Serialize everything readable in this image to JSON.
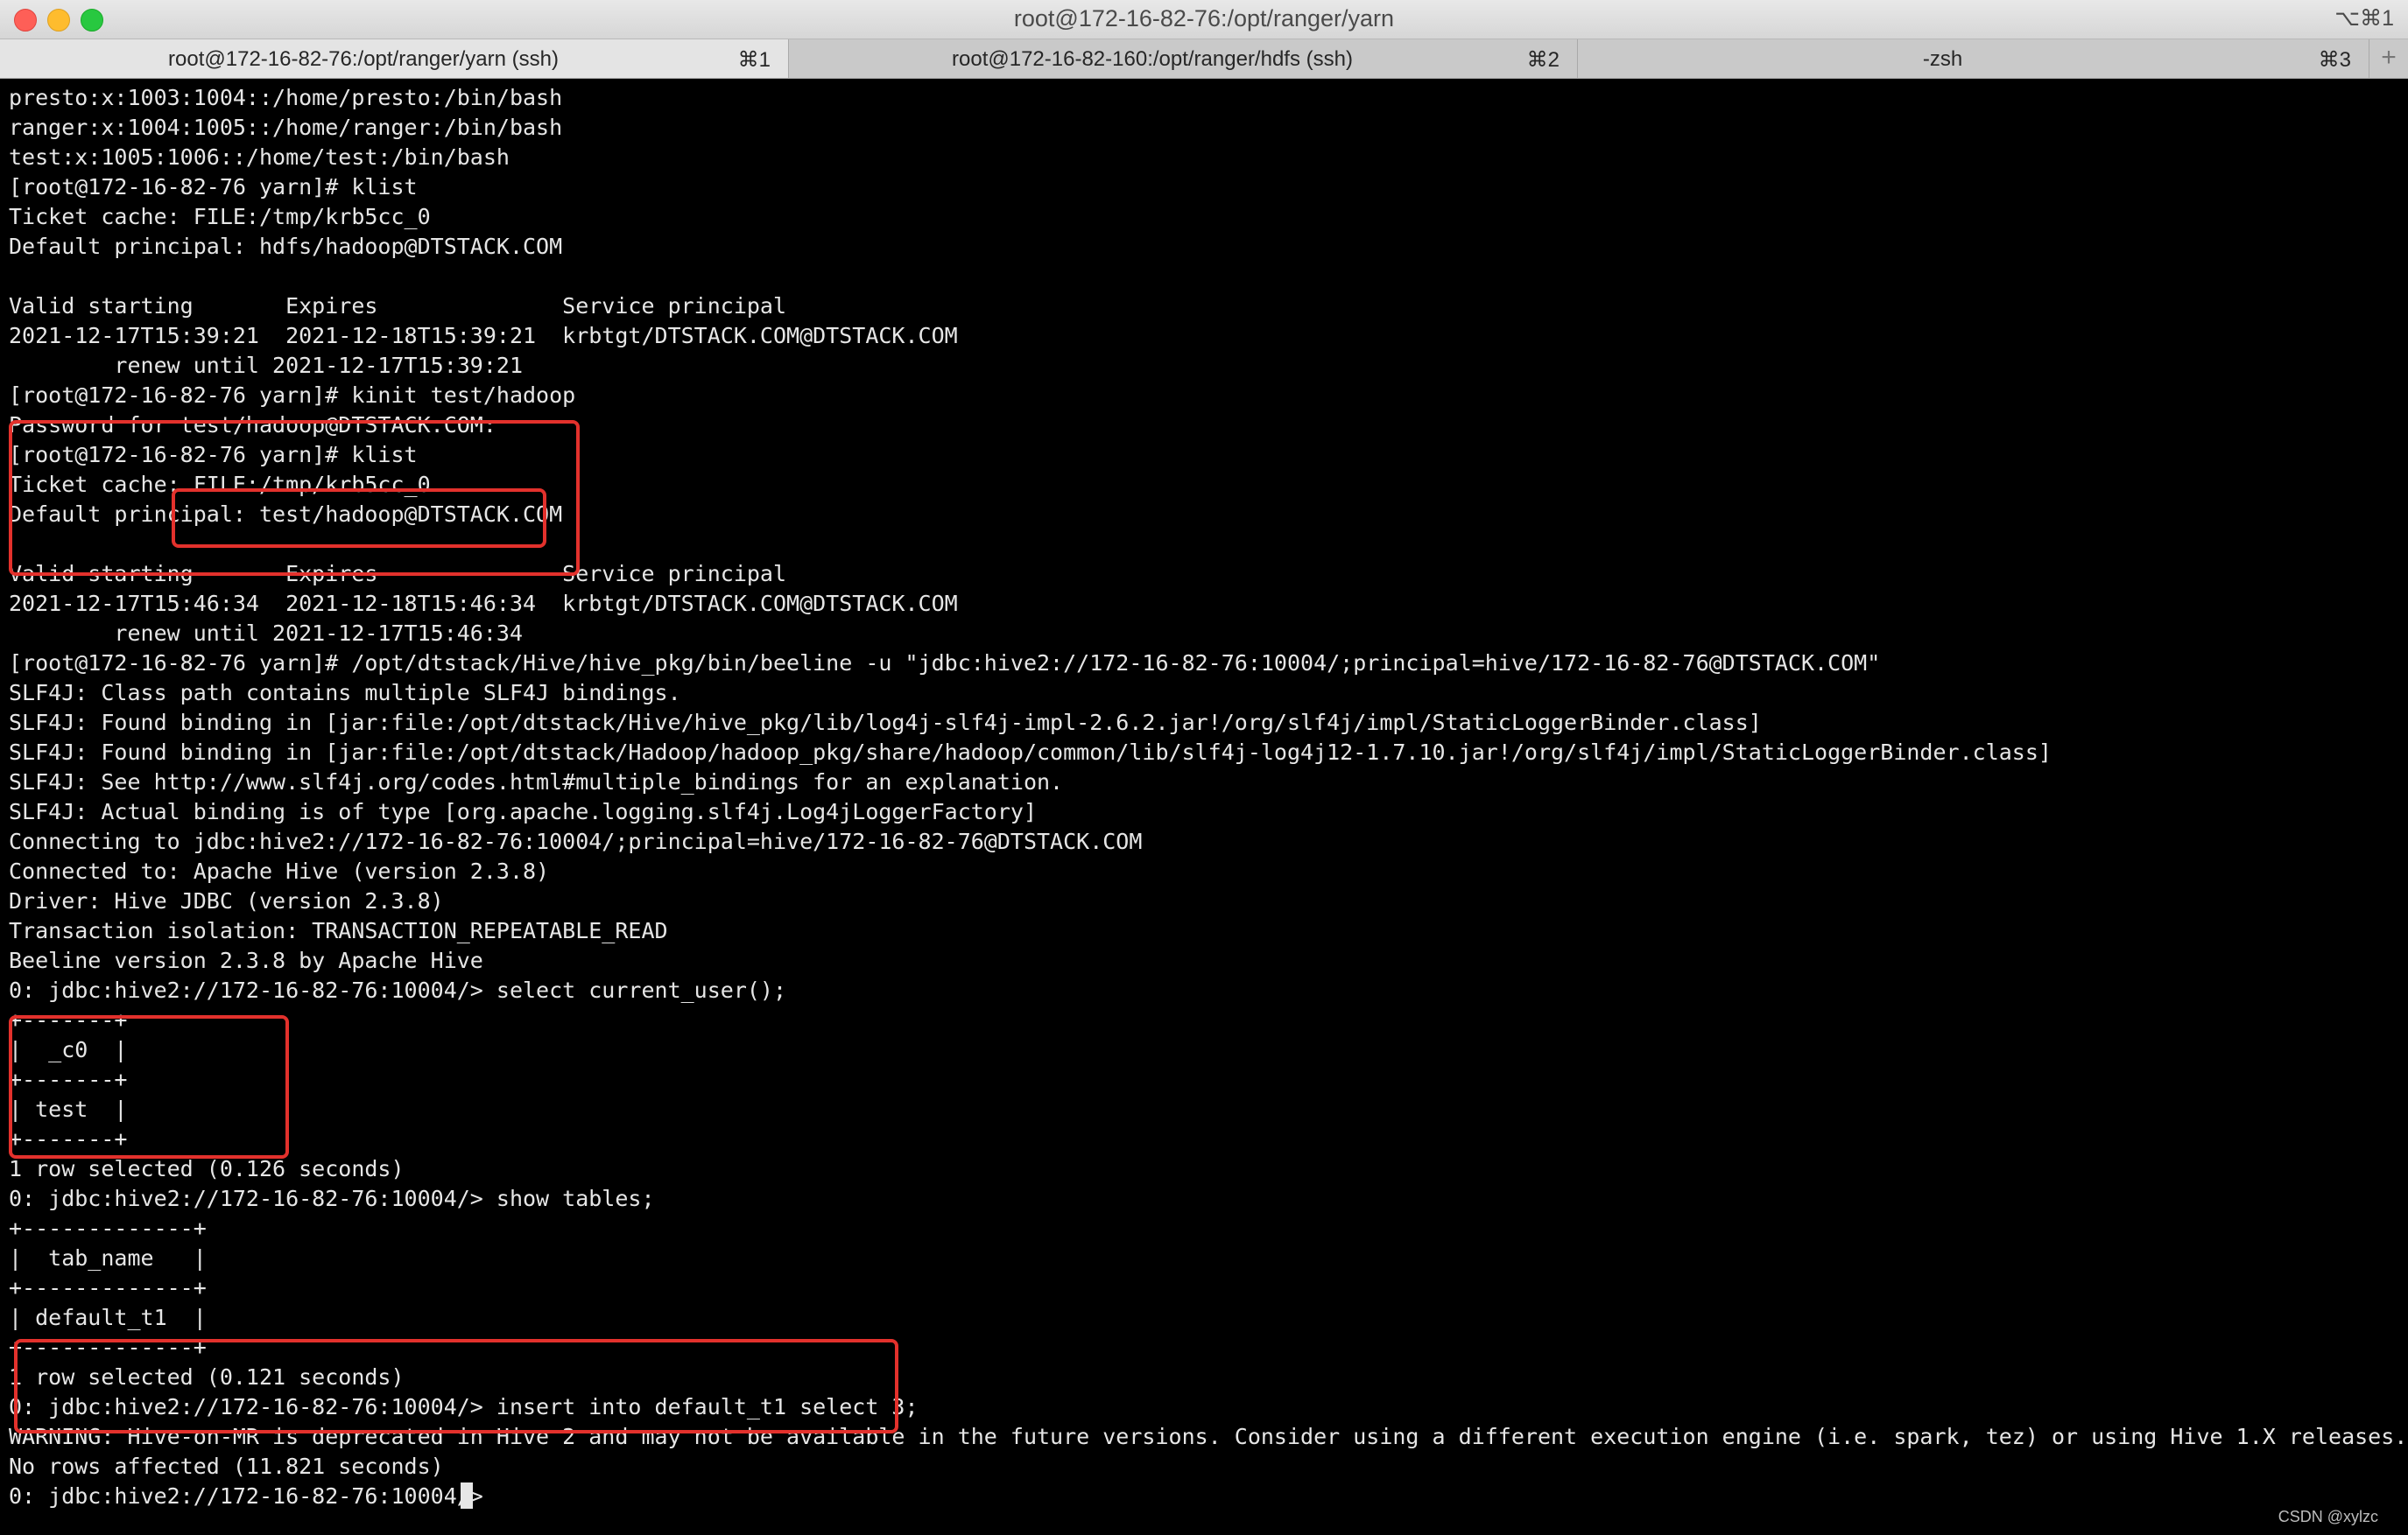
{
  "window": {
    "title": "root@172-16-82-76:/opt/ranger/yarn",
    "shortcut": "⌥⌘1"
  },
  "tabs": [
    {
      "label": "root@172-16-82-76:/opt/ranger/yarn (ssh)",
      "key": "⌘1",
      "active": true
    },
    {
      "label": "root@172-16-82-160:/opt/ranger/hdfs (ssh)",
      "key": "⌘2",
      "active": false
    },
    {
      "label": "-zsh",
      "key": "⌘3",
      "active": false
    }
  ],
  "new_tab_label": "+",
  "terminal": {
    "lines": [
      "presto:x:1003:1004::/home/presto:/bin/bash",
      "ranger:x:1004:1005::/home/ranger:/bin/bash",
      "test:x:1005:1006::/home/test:/bin/bash",
      "[root@172-16-82-76 yarn]# klist",
      "Ticket cache: FILE:/tmp/krb5cc_0",
      "Default principal: hdfs/hadoop@DTSTACK.COM",
      "",
      "Valid starting       Expires              Service principal",
      "2021-12-17T15:39:21  2021-12-18T15:39:21  krbtgt/DTSTACK.COM@DTSTACK.COM",
      "        renew until 2021-12-17T15:39:21",
      "[root@172-16-82-76 yarn]# kinit test/hadoop",
      "Password for test/hadoop@DTSTACK.COM:",
      "[root@172-16-82-76 yarn]# klist",
      "Ticket cache: FILE:/tmp/krb5cc_0",
      "Default principal: test/hadoop@DTSTACK.COM",
      "",
      "Valid starting       Expires              Service principal",
      "2021-12-17T15:46:34  2021-12-18T15:46:34  krbtgt/DTSTACK.COM@DTSTACK.COM",
      "        renew until 2021-12-17T15:46:34",
      "[root@172-16-82-76 yarn]# /opt/dtstack/Hive/hive_pkg/bin/beeline -u \"jdbc:hive2://172-16-82-76:10004/;principal=hive/172-16-82-76@DTSTACK.COM\"",
      "SLF4J: Class path contains multiple SLF4J bindings.",
      "SLF4J: Found binding in [jar:file:/opt/dtstack/Hive/hive_pkg/lib/log4j-slf4j-impl-2.6.2.jar!/org/slf4j/impl/StaticLoggerBinder.class]",
      "SLF4J: Found binding in [jar:file:/opt/dtstack/Hadoop/hadoop_pkg/share/hadoop/common/lib/slf4j-log4j12-1.7.10.jar!/org/slf4j/impl/StaticLoggerBinder.class]",
      "SLF4J: See http://www.slf4j.org/codes.html#multiple_bindings for an explanation.",
      "SLF4J: Actual binding is of type [org.apache.logging.slf4j.Log4jLoggerFactory]",
      "Connecting to jdbc:hive2://172-16-82-76:10004/;principal=hive/172-16-82-76@DTSTACK.COM",
      "Connected to: Apache Hive (version 2.3.8)",
      "Driver: Hive JDBC (version 2.3.8)",
      "Transaction isolation: TRANSACTION_REPEATABLE_READ",
      "Beeline version 2.3.8 by Apache Hive",
      "0: jdbc:hive2://172-16-82-76:10004/> select current_user();",
      "+-------+",
      "|  _c0  |",
      "+-------+",
      "| test  |",
      "+-------+",
      "1 row selected (0.126 seconds)",
      "0: jdbc:hive2://172-16-82-76:10004/> show tables;",
      "+-------------+",
      "|  tab_name   |",
      "+-------------+",
      "| default_t1  |",
      "+-------------+",
      "1 row selected (0.121 seconds)",
      "0: jdbc:hive2://172-16-82-76:10004/> insert into default_t1 select 3;",
      "WARNING: Hive-on-MR is deprecated in Hive 2 and may not be available in the future versions. Consider using a different execution engine (i.e. spark, tez) or using Hive 1.X releases.",
      "No rows affected (11.821 seconds)",
      "0: jdbc:hive2://172-16-82-76:10004/> "
    ]
  },
  "watermark": "CSDN @xylzc",
  "colors": {
    "terminal_bg": "#000000",
    "terminal_fg": "#e6e6e6",
    "annotation": "#e3312c"
  }
}
